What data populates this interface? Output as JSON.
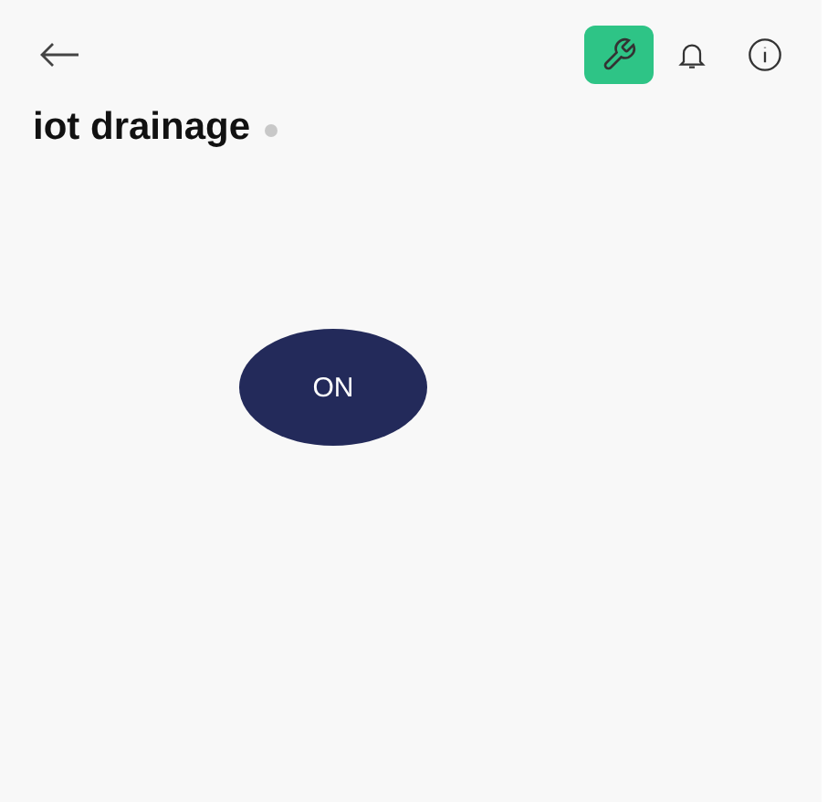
{
  "toolbar": {
    "actions": [
      {
        "kind": "wrench",
        "selected": true
      },
      {
        "kind": "bell",
        "selected": false
      },
      {
        "kind": "info",
        "selected": false
      }
    ]
  },
  "device": {
    "name": "iot drainage",
    "online": false
  },
  "switch_button": {
    "label": "ON"
  }
}
